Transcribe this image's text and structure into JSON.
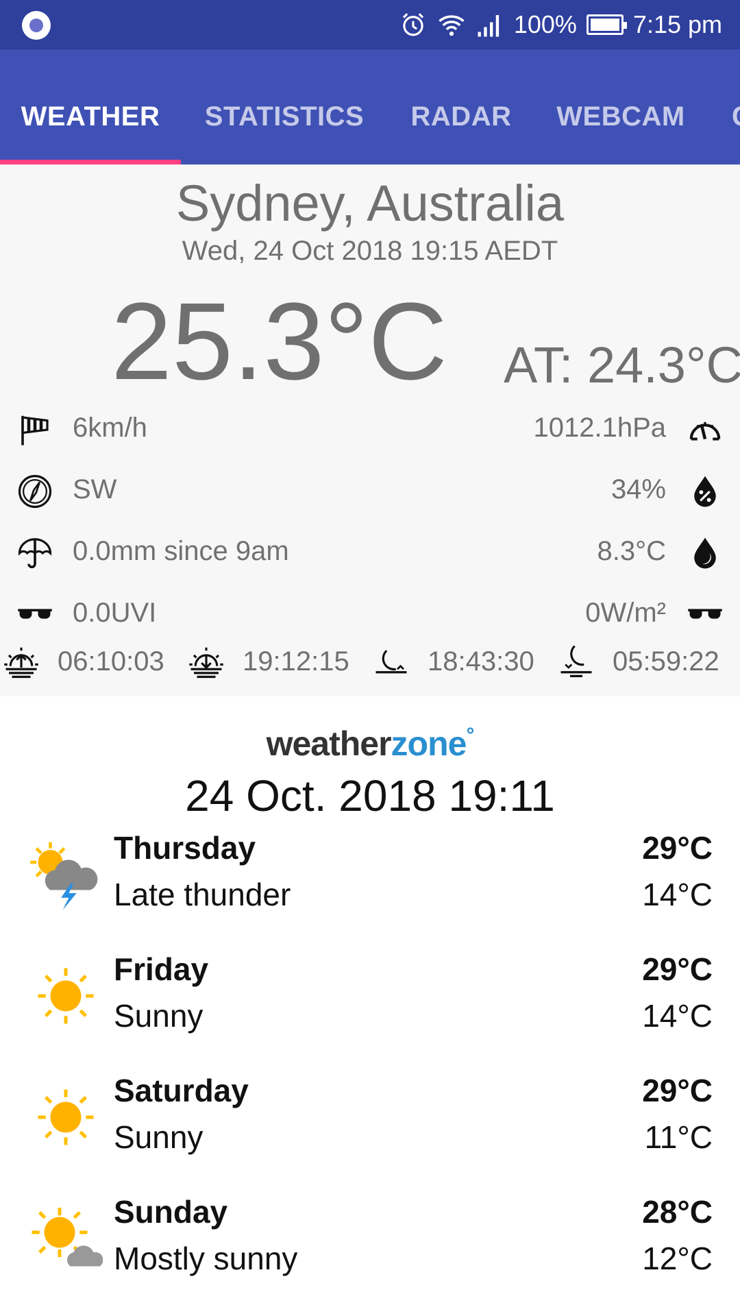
{
  "status_bar": {
    "battery": "100%",
    "time": "7:15 pm"
  },
  "tabs": [
    {
      "label": "WEATHER",
      "active": true
    },
    {
      "label": "STATISTICS",
      "active": false
    },
    {
      "label": "RADAR",
      "active": false
    },
    {
      "label": "WEBCAM",
      "active": false
    },
    {
      "label": "C",
      "active": false
    }
  ],
  "current": {
    "location": "Sydney, Australia",
    "datetime": "Wed, 24 Oct 2018 19:15 AEDT",
    "temperature": "25.3°C",
    "apparent": "AT: 24.3°C",
    "wind_speed": "6km/h",
    "pressure": "1012.1hPa",
    "wind_direction": "SW",
    "humidity": "34%",
    "rain": "0.0mm since 9am",
    "dew_point": "8.3°C",
    "uv": "0.0UVI",
    "solar": "0W/m²",
    "sunrise": "06:10:03",
    "sunset": "19:12:15",
    "moonrise": "18:43:30",
    "moonset": "05:59:22"
  },
  "forecast": {
    "provider_part1": "weather",
    "provider_part2": "zone",
    "provider_mark": "°",
    "issued": "24 Oct. 2018 19:11",
    "days": [
      {
        "day": "Thursday",
        "desc": "Late thunder",
        "high": "29°C",
        "low": "14°C",
        "icon": "thunder-icon"
      },
      {
        "day": "Friday",
        "desc": "Sunny",
        "high": "29°C",
        "low": "14°C",
        "icon": "sunny-icon"
      },
      {
        "day": "Saturday",
        "desc": "Sunny",
        "high": "29°C",
        "low": "11°C",
        "icon": "sunny-icon"
      },
      {
        "day": "Sunday",
        "desc": "Mostly sunny",
        "high": "28°C",
        "low": "12°C",
        "icon": "mostly-sunny-icon"
      }
    ]
  },
  "colors": {
    "primary": "#3f51b5",
    "status_bar": "#2e3f9c",
    "accent": "#ff4081",
    "text_grey": "#707070"
  }
}
